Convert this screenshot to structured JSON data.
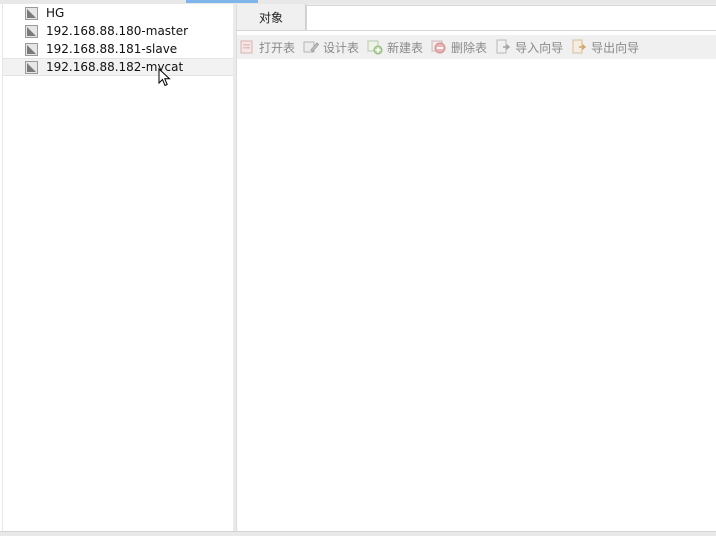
{
  "sidebar": {
    "connections": [
      {
        "label": "HG",
        "icon": "connection-icon"
      },
      {
        "label": "192.168.88.180-master",
        "icon": "connection-icon"
      },
      {
        "label": "192.168.88.181-slave",
        "icon": "connection-icon"
      },
      {
        "label": "192.168.88.182-mycat",
        "icon": "connection-icon",
        "selected": true
      }
    ]
  },
  "main": {
    "tabs": [
      {
        "label": "对象"
      }
    ],
    "toolbar": {
      "open_table": "打开表",
      "design_table": "设计表",
      "new_table": "新建表",
      "delete_table": "删除表",
      "import_wizard": "导入向导",
      "export_wizard": "导出向导"
    }
  },
  "colors": {
    "selected_row": "#f2f2f2",
    "toolbar_bg": "#f0f0f0",
    "disabled_text": "#8a8a8a",
    "accent": "#7fb5e8"
  }
}
